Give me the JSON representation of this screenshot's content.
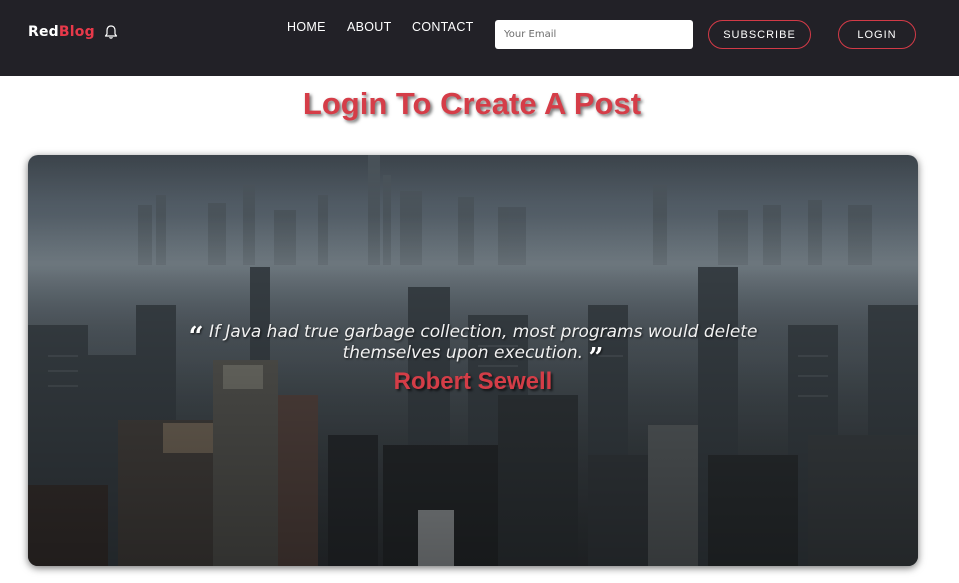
{
  "navbar": {
    "brand": {
      "part1": "Red",
      "part2": "Blog"
    },
    "bell_icon": "bell-icon",
    "links": [
      {
        "label": "HOME"
      },
      {
        "label": "ABOUT"
      },
      {
        "label": "CONTACT"
      }
    ],
    "email_placeholder": "Your Email",
    "subscribe_label": "SUBSCRIBE",
    "login_label": "LOGIN"
  },
  "main": {
    "title": "Login To Create A Post",
    "hero": {
      "quote_open_icon": "quote-open-icon",
      "quote_close_icon": "quote-close-icon",
      "quote_line1": "If Java had true garbage collection, most programs would delete",
      "quote_line2": "themselves upon execution.",
      "author": "Robert Sewell"
    }
  },
  "colors": {
    "navbar_bg": "#222127",
    "accent": "#d53d48",
    "button_border": "#d33a47"
  }
}
